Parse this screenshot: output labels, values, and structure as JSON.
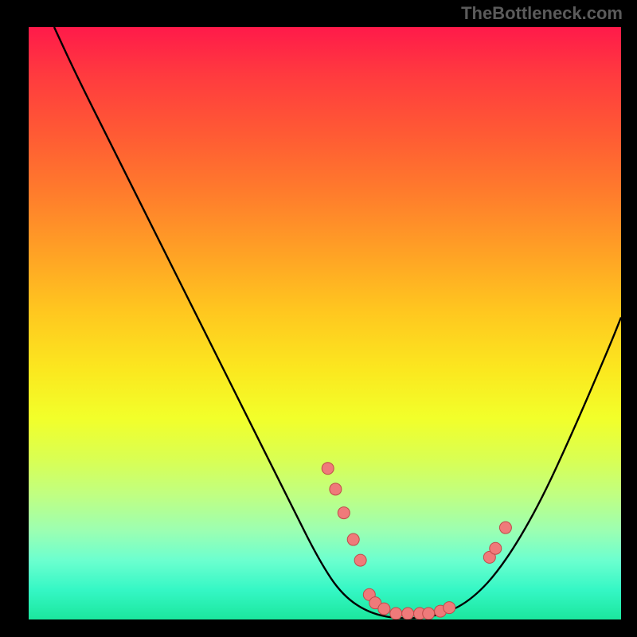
{
  "watermark": "TheBottleneck.com",
  "chart_data": {
    "type": "line",
    "title": "",
    "xlabel": "",
    "ylabel": "",
    "xlim": [
      0,
      100
    ],
    "ylim": [
      0,
      100
    ],
    "curve": [
      {
        "x": 4.3,
        "y": 100
      },
      {
        "x": 8,
        "y": 92
      },
      {
        "x": 14,
        "y": 80
      },
      {
        "x": 22,
        "y": 64
      },
      {
        "x": 30,
        "y": 48
      },
      {
        "x": 38,
        "y": 32
      },
      {
        "x": 44,
        "y": 20
      },
      {
        "x": 49,
        "y": 10
      },
      {
        "x": 53,
        "y": 4
      },
      {
        "x": 58,
        "y": 0.8
      },
      {
        "x": 64,
        "y": 0
      },
      {
        "x": 70,
        "y": 0.8
      },
      {
        "x": 75,
        "y": 3.5
      },
      {
        "x": 80,
        "y": 9
      },
      {
        "x": 86,
        "y": 19
      },
      {
        "x": 92,
        "y": 32
      },
      {
        "x": 98,
        "y": 46
      },
      {
        "x": 100,
        "y": 51
      }
    ],
    "points": [
      {
        "x": 50.5,
        "y": 25.5
      },
      {
        "x": 51.8,
        "y": 22
      },
      {
        "x": 53.2,
        "y": 18
      },
      {
        "x": 54.8,
        "y": 13.5
      },
      {
        "x": 56.0,
        "y": 10
      },
      {
        "x": 57.5,
        "y": 4.2
      },
      {
        "x": 58.5,
        "y": 2.8
      },
      {
        "x": 60.0,
        "y": 1.8
      },
      {
        "x": 62.0,
        "y": 1.0
      },
      {
        "x": 64.0,
        "y": 1.0
      },
      {
        "x": 66.0,
        "y": 1.0
      },
      {
        "x": 67.5,
        "y": 1.0
      },
      {
        "x": 69.5,
        "y": 1.4
      },
      {
        "x": 71.0,
        "y": 2.0
      },
      {
        "x": 77.8,
        "y": 10.5
      },
      {
        "x": 78.8,
        "y": 12
      },
      {
        "x": 80.5,
        "y": 15.5
      }
    ],
    "colors": {
      "curve": "#000000",
      "point_fill": "#ef7a7a",
      "point_stroke": "#c04a4a"
    }
  }
}
